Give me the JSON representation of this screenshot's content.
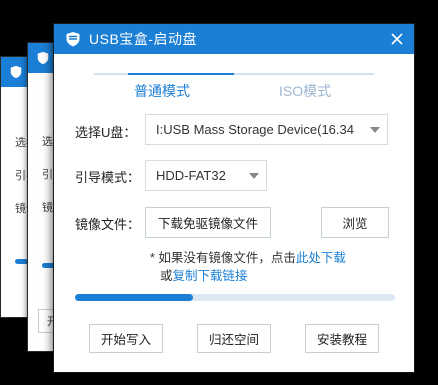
{
  "window": {
    "title": "USB宝盒-启动盘",
    "accent_color": "#1b7fd6"
  },
  "tabs": [
    {
      "label": "普通模式",
      "active": true
    },
    {
      "label": "ISO模式",
      "active": false
    }
  ],
  "form": {
    "usb_label": "选择U盘：",
    "usb_value": "I:USB Mass Storage Device(16.34",
    "boot_label": "引导模式：",
    "boot_value": "HDD-FAT32",
    "image_label": "镜像文件：",
    "download_image_label": "下载免驱镜像文件",
    "browse_label": "浏览"
  },
  "note": {
    "line1_prefix": "* 如果没有镜像文件，点击",
    "line1_link": "此处下载",
    "line2_prefix": "或",
    "line2_link": "复制下载链接"
  },
  "progress": {
    "value_fraction": 0.37
  },
  "buttons": {
    "start_write": "开始写入",
    "restore_space": "归还空间",
    "install_tutorial": "安装教程"
  },
  "background_windows": {
    "labels": [
      "选择U盘",
      "引导模式",
      "镜像文件"
    ],
    "bg2_labels": [
      "选择U",
      "引导模",
      "镜像文"
    ],
    "bg2_button": "开"
  }
}
